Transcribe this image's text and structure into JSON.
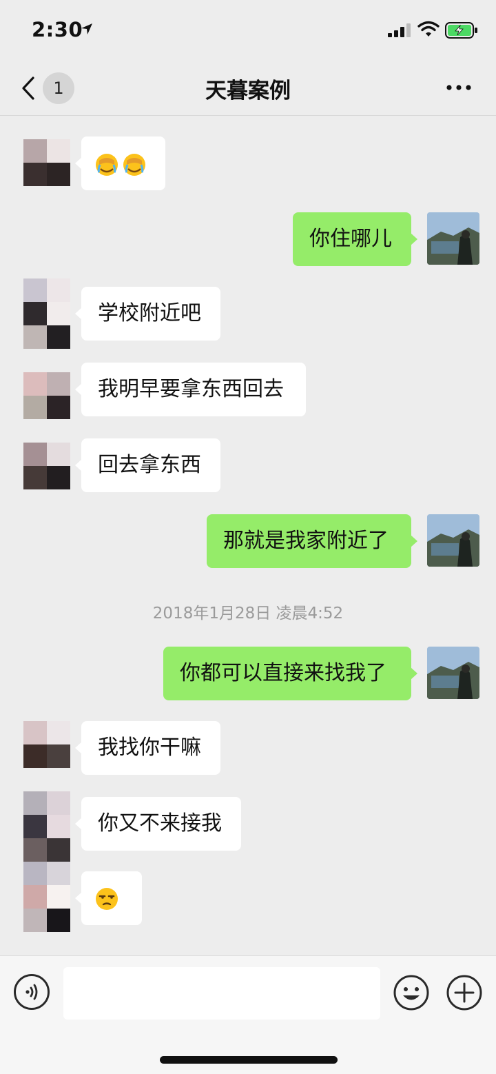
{
  "status_bar": {
    "time": "2:30"
  },
  "nav": {
    "unread_count": "1",
    "title": "天暮案例"
  },
  "messages": {
    "m2": "你住哪儿",
    "m3": "学校附近吧",
    "m4": "我明早要拿东西回去",
    "m5": "回去拿东西",
    "m6": "那就是我家附近了",
    "m7": "你都可以直接来找我了",
    "m8": "我找你干嘛",
    "m9": "你又不来接我"
  },
  "timestamp": "2018年1月28日 凌晨4:52",
  "input": {
    "value": "",
    "placeholder": ""
  },
  "colors": {
    "sent_bubble": "#95ec69",
    "received_bubble": "#ffffff",
    "background": "#ededed"
  },
  "icons": [
    "location-arrow-icon",
    "signal-icon",
    "wifi-icon",
    "battery-icon",
    "back-icon",
    "more-icon",
    "facepalm-cry-emoji",
    "unamused-emoji",
    "voice-icon",
    "emoji-icon",
    "plus-icon"
  ]
}
